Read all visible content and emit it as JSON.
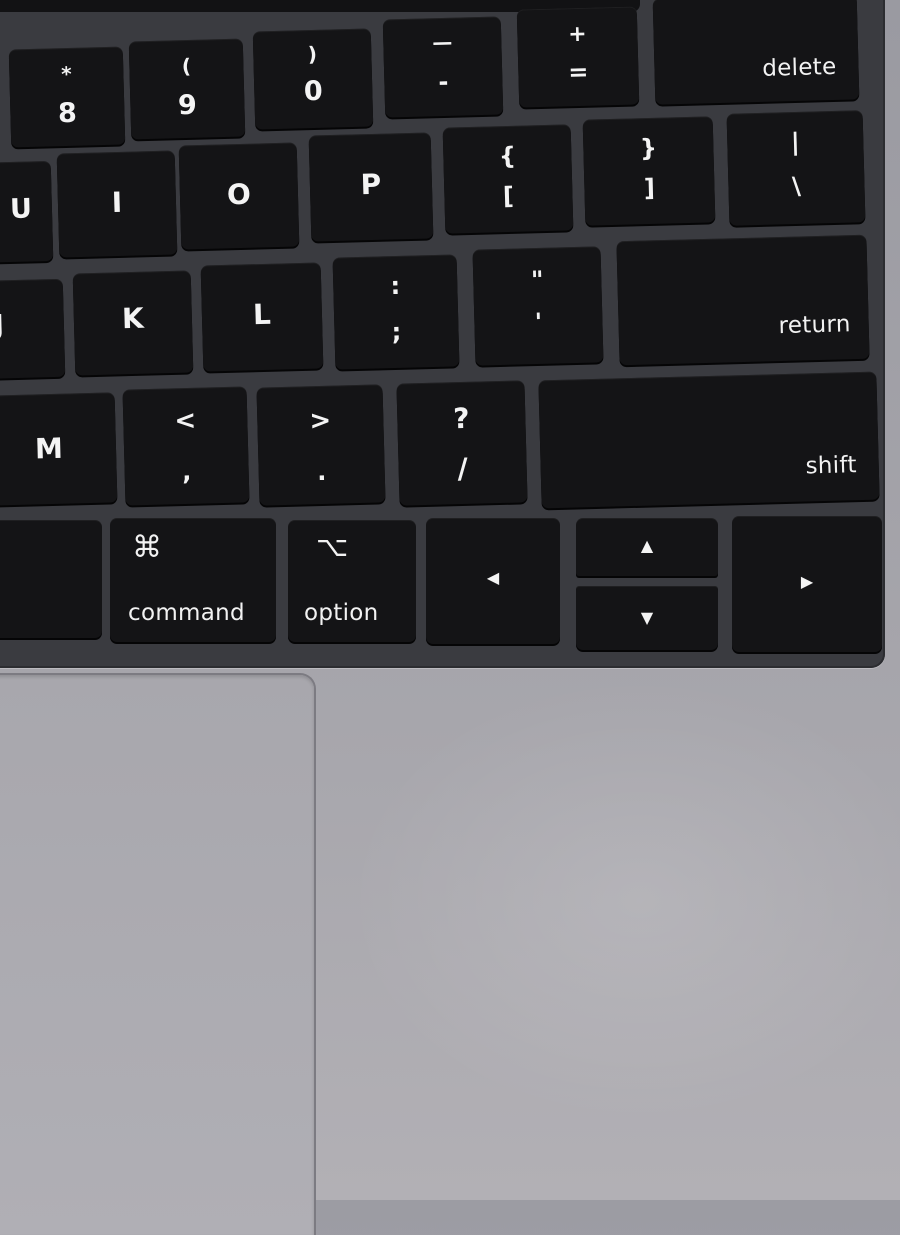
{
  "keys": {
    "k8": {
      "top": "*",
      "bottom": "8"
    },
    "k9": {
      "top": "(",
      "bottom": "9"
    },
    "k0": {
      "top": ")",
      "bottom": "0"
    },
    "minus": {
      "top": "—",
      "bottom": "-"
    },
    "equals": {
      "top": "+",
      "bottom": "="
    },
    "delete": "delete",
    "u": "U",
    "i": "I",
    "o": "O",
    "p": "P",
    "lbracket": {
      "top": "{",
      "bottom": "["
    },
    "rbracket": {
      "top": "}",
      "bottom": "]"
    },
    "backslash": {
      "top": "|",
      "bottom": "\\"
    },
    "j": "J",
    "k": "K",
    "l": "L",
    "semicolon": {
      "top": ":",
      "bottom": ";"
    },
    "quote": {
      "top": "\"",
      "bottom": "'"
    },
    "return": "return",
    "m": "M",
    "comma": {
      "top": "<",
      "bottom": ","
    },
    "period": {
      "top": ">",
      "bottom": "."
    },
    "slash": {
      "top": "?",
      "bottom": "/"
    },
    "shift": "shift",
    "command": {
      "symbol": "⌘",
      "word": "command"
    },
    "option": {
      "symbol": "⌥",
      "word": "option"
    },
    "arrow_left": "◀",
    "arrow_up": "▲",
    "arrow_down": "▼",
    "arrow_right": "▶"
  },
  "touch_bar": {
    "icon1": "☆"
  }
}
